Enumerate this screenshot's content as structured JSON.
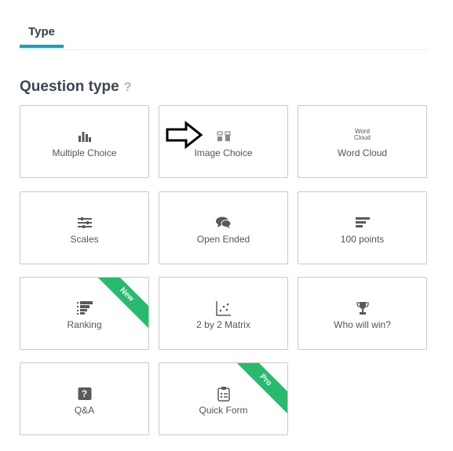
{
  "tabs": {
    "type_label": "Type"
  },
  "section": {
    "title": "Question type",
    "help_glyph": "?"
  },
  "cards": [
    {
      "label": "Multiple Choice",
      "icon": "bar-chart-icon"
    },
    {
      "label": "Image Choice",
      "icon": "image-choice-icon"
    },
    {
      "label": "Word Cloud",
      "icon": "word-cloud-icon",
      "icon_words": [
        "Word",
        "Cloud"
      ]
    },
    {
      "label": "Scales",
      "icon": "sliders-icon"
    },
    {
      "label": "Open Ended",
      "icon": "speech-bubbles-icon"
    },
    {
      "label": "100 points",
      "icon": "horizontal-bars-icon"
    },
    {
      "label": "Ranking",
      "icon": "ranking-icon",
      "badge": "New"
    },
    {
      "label": "2 by 2 Matrix",
      "icon": "scatter-matrix-icon"
    },
    {
      "label": "Who will win?",
      "icon": "trophy-icon"
    },
    {
      "label": "Q&A",
      "icon": "question-bubble-icon",
      "icon_glyph": "?"
    },
    {
      "label": "Quick Form",
      "icon": "clipboard-form-icon",
      "badge": "Pro"
    }
  ],
  "colors": {
    "accent": "#1aa1b3",
    "ribbon": "#28bb6e",
    "icon": "#5a5a5a"
  }
}
